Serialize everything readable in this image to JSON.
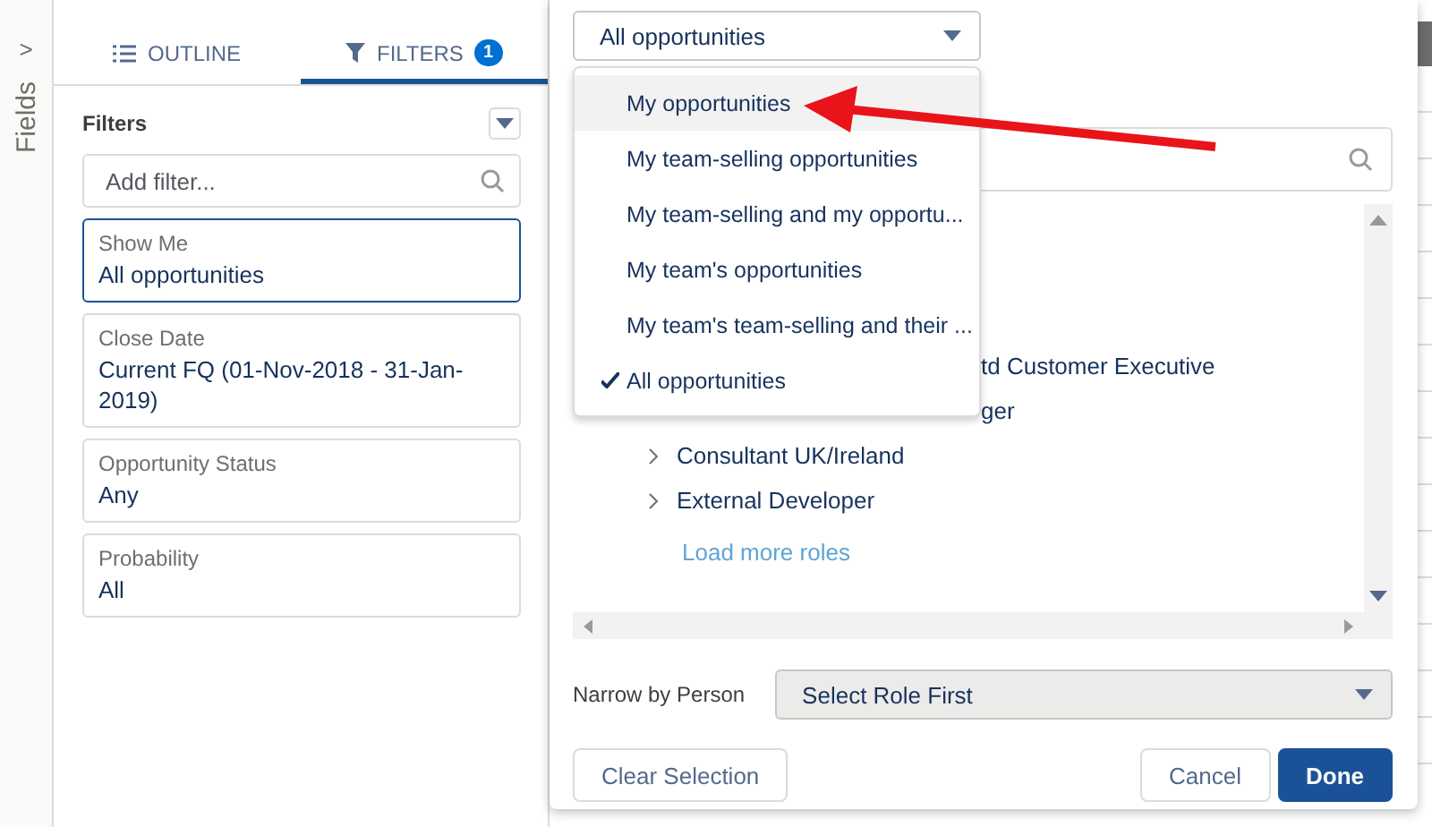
{
  "fields_rail": {
    "label": "Fields",
    "toggle": ">"
  },
  "tabs": [
    {
      "label": "OUTLINE",
      "selected": false
    },
    {
      "label": "FILTERS",
      "badge": "1",
      "selected": true
    }
  ],
  "filters": {
    "title": "Filters",
    "search": {
      "placeholder": "Add filter..."
    },
    "items": [
      {
        "label": "Show Me",
        "value": "All opportunities",
        "selected": true
      },
      {
        "label": "Close Date",
        "value": "Current FQ (01-Nov-2018 - 31-Jan-2019)",
        "selected": false
      },
      {
        "label": "Opportunity Status",
        "value": "Any",
        "selected": false
      },
      {
        "label": "Probability",
        "value": "All",
        "selected": false
      }
    ]
  },
  "dialog": {
    "show_select": {
      "value": "All opportunities"
    },
    "menu": [
      {
        "label": "My opportunities",
        "checked": false,
        "selected": true
      },
      {
        "label": "My team-selling opportunities",
        "checked": false,
        "selected": false
      },
      {
        "label": "My team-selling and my opportu...",
        "checked": false,
        "selected": false
      },
      {
        "label": "My team's opportunities",
        "checked": false,
        "selected": false
      },
      {
        "label": "My team's team-selling and their ...",
        "checked": false,
        "selected": false
      },
      {
        "label": "All opportunities",
        "checked": true,
        "selected": false
      }
    ],
    "roles": [
      {
        "label": "td Customer Executive",
        "kind": "partial"
      },
      {
        "label": "ger",
        "kind": "partial"
      },
      {
        "label": "Consultant UK/Ireland",
        "kind": "role"
      },
      {
        "label": "External Developer",
        "kind": "role"
      },
      {
        "label": "Load more roles",
        "kind": "link"
      }
    ],
    "narrow_label": "Narrow by Person",
    "narrow_select": {
      "value": "Select Role First",
      "disabled": true
    },
    "buttons": [
      {
        "label": "Clear Selection",
        "kind": "neutral"
      },
      {
        "label": "Cancel",
        "kind": "neutral"
      },
      {
        "label": "Done",
        "kind": "brand"
      }
    ]
  }
}
